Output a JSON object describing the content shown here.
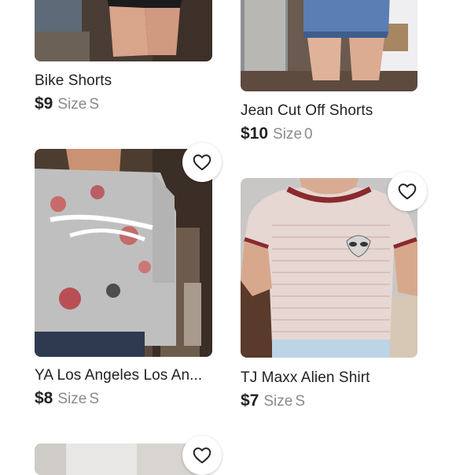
{
  "listings": [
    {
      "title": "Bike Shorts",
      "price": "$9",
      "size_label": "Size",
      "size": "S",
      "photo": "bike-shorts-photo"
    },
    {
      "title": "Jean Cut Off Shorts",
      "price": "$10",
      "size_label": "Size",
      "size": "0",
      "photo": "jean-shorts-photo"
    },
    {
      "title": "YA Los Angeles Los An...",
      "price": "$8",
      "size_label": "Size",
      "size": "S",
      "photo": "floral-sweatshirt-photo"
    },
    {
      "title": "TJ Maxx Alien Shirt",
      "price": "$7",
      "size_label": "Size",
      "size": "S",
      "photo": "alien-shirt-photo"
    }
  ],
  "icons": {
    "like": "heart-outline-icon"
  },
  "colors": {
    "text": "#222222",
    "muted": "#8a8a8a",
    "background": "#ffffff"
  }
}
